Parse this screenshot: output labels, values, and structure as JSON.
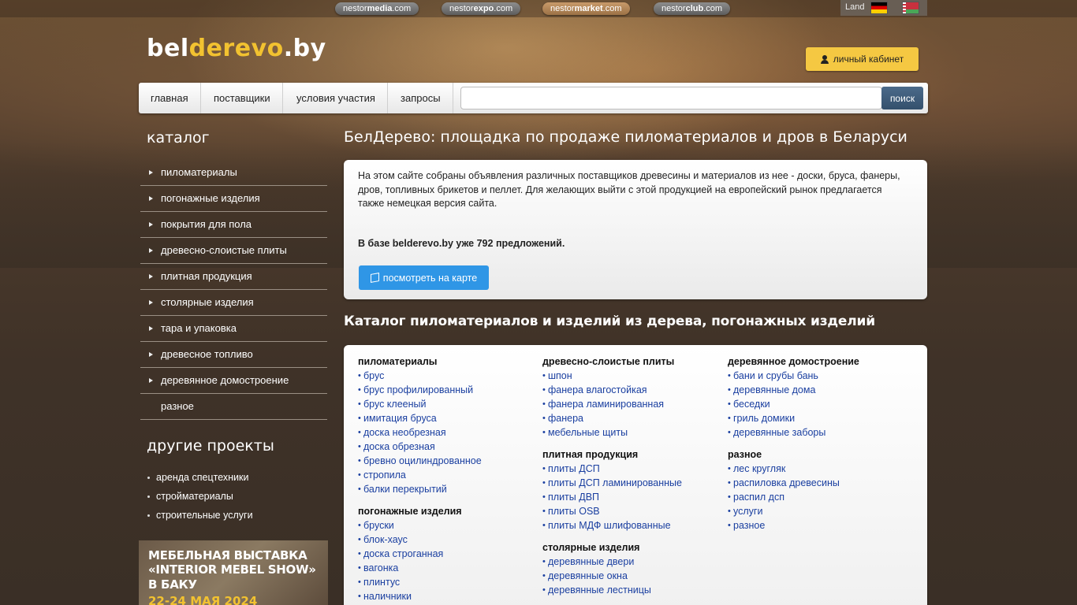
{
  "network": {
    "links": [
      {
        "prefix": "nestor",
        "bold": "media",
        "suffix": ".com"
      },
      {
        "prefix": "nestor",
        "bold": "expo",
        "suffix": ".com"
      },
      {
        "prefix": "nestor",
        "bold": "market",
        "suffix": ".com"
      },
      {
        "prefix": "nestor",
        "bold": "club",
        "suffix": ".com"
      }
    ],
    "lang_label": "Land"
  },
  "header": {
    "logo_part1": "bel",
    "logo_part2": "derevo",
    "logo_part3": ".by",
    "cabinet_label": "личный кабинет"
  },
  "nav": {
    "items": [
      "главная",
      "поставщики",
      "условия участия",
      "запросы"
    ],
    "search_placeholder": "",
    "search_button": "поиск"
  },
  "sidebar": {
    "catalog_title": "каталог",
    "catalog_items": [
      "пиломатериалы",
      "погонажные изделия",
      "покрытия для пола",
      "древесно-слоистые плиты",
      "плитная продукция",
      "столярные изделия",
      "тара и упаковка",
      "древесное топливо",
      "деревянное домостроение",
      "разное"
    ],
    "projects_title": "другие проекты",
    "projects": [
      "аренда спецтехники",
      "стройматериалы",
      "строительные услуги"
    ],
    "banner": {
      "line1": "МЕБЕЛЬНАЯ ВЫСТАВКА",
      "line2": "«INTERIOR MEBEL SHOW»",
      "line3": "В БАКУ",
      "date": "22-24 МАЯ 2024"
    }
  },
  "main": {
    "title": "БелДерево: площадка по продаже пиломатериалов и дров в Беларуси",
    "intro": "На этом сайте собраны объявления различных поставщиков древесины и материалов из нее - доски, бруса, фанеры, дров, топливных брикетов и пеллет. Для желающих выйти с этой продукцией на европейский рынок предлагается также немецкая версия сайта.",
    "count_text": "В базе belderevo.by уже 792 предложений.",
    "map_button": "посмотреть на карте",
    "catalog_title": "Каталог пиломатериалов и изделий из дерева, погонажных изделий",
    "columns": [
      [
        {
          "title": "пиломатериалы",
          "links": [
            "брус",
            "брус профилированный",
            "брус клееный",
            "имитация бруса",
            "доска необрезная",
            "доска обрезная",
            "бревно оцилиндрованное",
            "стропила",
            "балки перекрытий"
          ]
        },
        {
          "title": "погонажные изделия",
          "links": [
            "бруски",
            "блок-хаус",
            "доска строганная",
            "вагонка",
            "плинтус",
            "наличники"
          ]
        }
      ],
      [
        {
          "title": "древесно-слоистые плиты",
          "links": [
            "шпон",
            "фанера влагостойкая",
            "фанера ламинированная",
            "фанера",
            "мебельные щиты"
          ]
        },
        {
          "title": "плитная продукция",
          "links": [
            "плиты ДСП",
            "плиты ДСП ламинированные",
            "плиты ДВП",
            "плиты OSB",
            "плиты МДФ шлифованные"
          ]
        },
        {
          "title": "столярные изделия",
          "links": [
            "деревянные двери",
            "деревянные окна",
            "деревянные лестницы"
          ]
        }
      ],
      [
        {
          "title": "деревянное домостроение",
          "links": [
            "бани и срубы бань",
            "деревянные дома",
            "беседки",
            "гриль домики",
            "деревянные заборы"
          ]
        },
        {
          "title": "разное",
          "links": [
            "лес кругляк",
            "распиловка древесины",
            "распил дсп",
            "услуги",
            "разное"
          ]
        }
      ]
    ]
  }
}
